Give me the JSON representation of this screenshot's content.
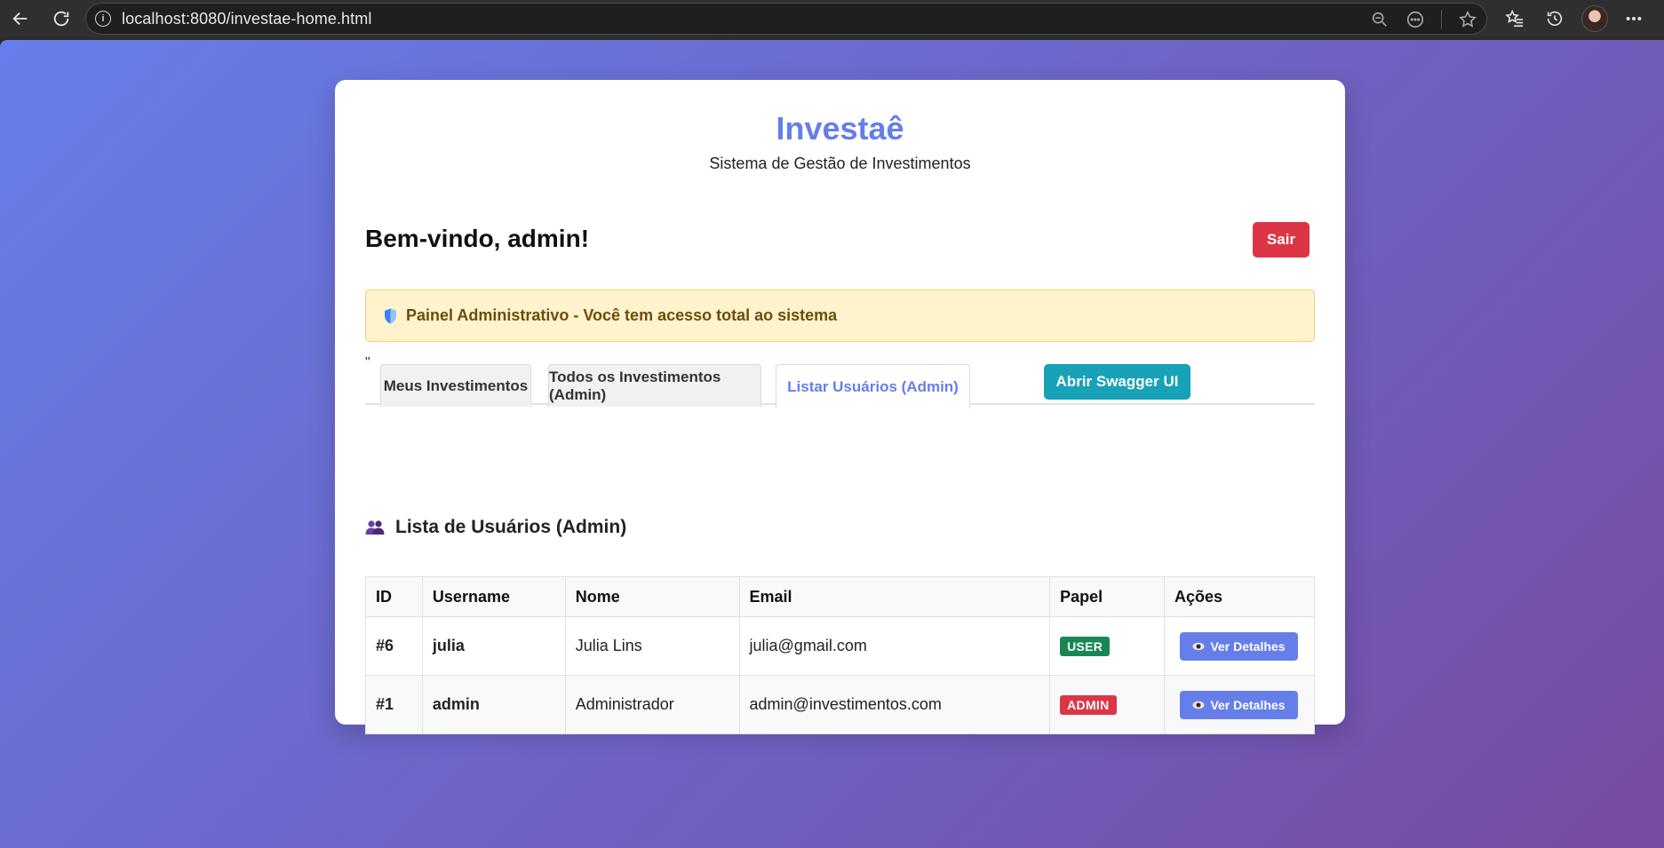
{
  "browser": {
    "url": "localhost:8080/investae-home.html"
  },
  "header": {
    "brand": "Investaê",
    "subtitle": "Sistema de Gestão de Investimentos"
  },
  "user_bar": {
    "welcome": "Bem-vindo, admin!",
    "logout_label": "Sair"
  },
  "admin_banner": {
    "text": "Painel Administrativo - Você tem acesso total ao sistema"
  },
  "stray_text": "\"",
  "tabs": [
    {
      "label": "Meus Investimentos",
      "active": false
    },
    {
      "label": "Todos os Investimentos (Admin)",
      "active": false
    },
    {
      "label": "Listar Usuários (Admin)",
      "active": true
    }
  ],
  "swagger_button": "Abrir Swagger UI",
  "users_section": {
    "title": "Lista de Usuários (Admin)",
    "columns": [
      "ID",
      "Username",
      "Nome",
      "Email",
      "Papel",
      "Ações"
    ],
    "rows": [
      {
        "id": "#6",
        "username": "julia",
        "name": "Julia Lins",
        "email": "julia@gmail.com",
        "role": "USER",
        "action": "Ver Detalhes"
      },
      {
        "id": "#1",
        "username": "admin",
        "name": "Administrador",
        "email": "admin@investimentos.com",
        "role": "ADMIN",
        "action": "Ver Detalhes"
      }
    ]
  },
  "colors": {
    "brand": "#667eea",
    "danger": "#dc3545",
    "success": "#198754",
    "info": "#17a2b8",
    "warning_bg": "#fff3cd"
  },
  "icons": {
    "shield": "shield-icon",
    "users": "users-icon",
    "eye": "eye-icon"
  }
}
